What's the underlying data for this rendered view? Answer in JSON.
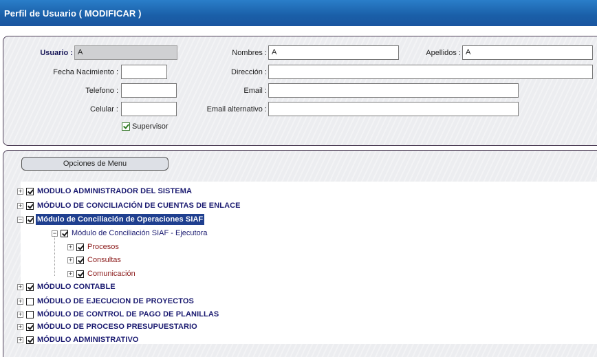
{
  "window": {
    "title": "Perfil de Usuario ( MODIFICAR )"
  },
  "form": {
    "usuario_label": "Usuario :",
    "usuario_value": "A",
    "nombres_label": "Nombres :",
    "nombres_value": "A",
    "apellidos_label": "Apellidos :",
    "apellidos_value": "A",
    "fecha_label": "Fecha Nacimiento :",
    "fecha_value": "",
    "direccion_label": "Dirección :",
    "direccion_value": "",
    "telefono_label": "Telefono :",
    "telefono_value": "",
    "email_label": "Email :",
    "email_value": "",
    "celular_label": "Celular :",
    "celular_value": "",
    "email_alt_label": "Email alternativo :",
    "email_alt_value": "",
    "supervisor_label": "Supervisor",
    "supervisor_checked": true
  },
  "menu_tab": {
    "label": "Opciones de Menu"
  },
  "tree": {
    "items": [
      {
        "label": "MODULO ADMINISTRADOR DEL SISTEMA",
        "checked": true
      },
      {
        "label": "MÓDULO DE CONCILIACIÓN DE CUENTAS DE ENLACE",
        "checked": true
      },
      {
        "label": "Módulo de Conciliación de Operaciones SIAF",
        "checked": true,
        "selected": true,
        "expanded": true
      },
      {
        "label": "Módulo de Conciliación SIAF - Ejecutora",
        "checked": true,
        "expanded": true
      },
      {
        "label": "Procesos",
        "checked": true
      },
      {
        "label": "Consultas",
        "checked": true
      },
      {
        "label": "Comunicación",
        "checked": true
      },
      {
        "label": "MÓDULO CONTABLE",
        "checked": true
      },
      {
        "label": "MÓDULO DE EJECUCION DE PROYECTOS",
        "checked": false
      },
      {
        "label": "MÓDULO DE CONTROL DE PAGO DE PLANILLAS",
        "checked": false
      },
      {
        "label": "MÓDULO DE PROCESO PRESUPUESTARIO",
        "checked": true
      },
      {
        "label": "MÓDULO ADMINISTRATIVO",
        "checked": true
      }
    ]
  }
}
